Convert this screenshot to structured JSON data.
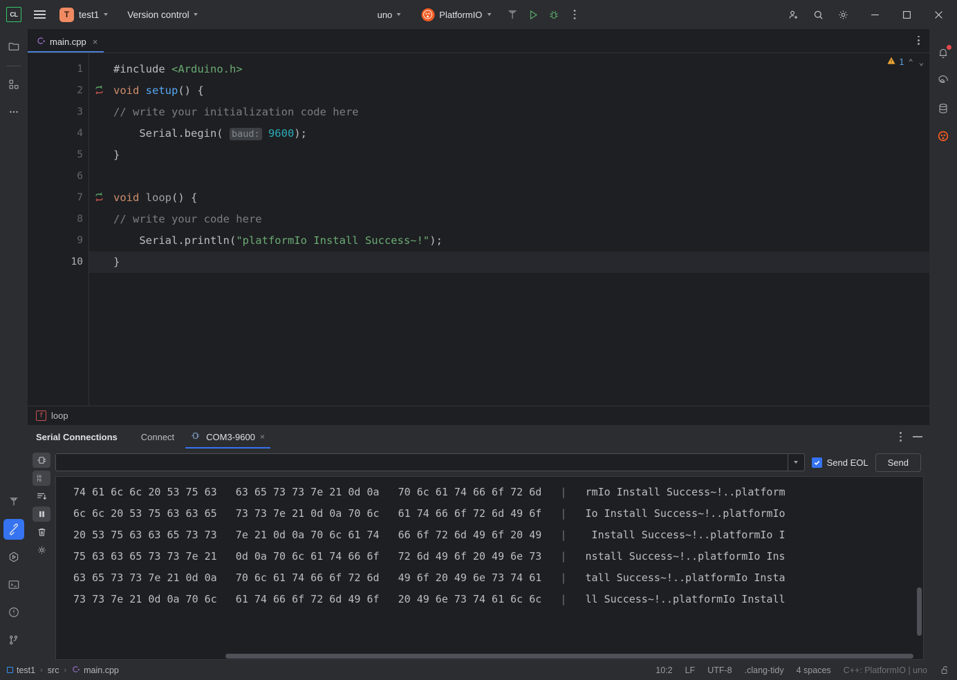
{
  "titlebar": {
    "logo_text": "CL",
    "menu_icon": "hamburger-icon",
    "project_initial": "T",
    "project_name": "test1",
    "vcs_label": "Version control",
    "run_config": "uno",
    "platformio_label": "PlatformIO",
    "icons": {
      "build": "hammer-icon",
      "run": "run-icon",
      "debug": "debug-icon",
      "more": "more-vertical-icon",
      "account": "account-add-icon",
      "search": "search-icon",
      "settings": "gear-icon",
      "minimize": "window-minimize-icon",
      "maximize": "window-maximize-icon",
      "close": "window-close-icon"
    }
  },
  "left_rail": {
    "items": [
      {
        "name": "project-tool-icon",
        "label": "Project"
      },
      {
        "name": "structure-tool-icon",
        "label": "Structure"
      },
      {
        "name": "more-tool-windows-icon",
        "label": "More tool windows"
      }
    ],
    "bottom_items": [
      {
        "name": "build-tool-icon",
        "label": "Build",
        "active": false
      },
      {
        "name": "platformio-tool-icon",
        "label": "PlatformIO",
        "active": true
      },
      {
        "name": "run-tool-icon",
        "label": "Run",
        "active": false
      },
      {
        "name": "terminal-tool-icon",
        "label": "Terminal",
        "active": false
      },
      {
        "name": "problems-tool-icon",
        "label": "Problems",
        "active": false
      },
      {
        "name": "version-control-tool-icon",
        "label": "Version Control",
        "active": false
      }
    ]
  },
  "right_rail": {
    "items": [
      {
        "name": "notifications-icon",
        "label": "Notifications",
        "badge": true
      },
      {
        "name": "ai-assistant-icon",
        "label": "AI Assistant",
        "badge": false
      },
      {
        "name": "database-icon",
        "label": "Database",
        "badge": false
      },
      {
        "name": "platformio-icon",
        "label": "PlatformIO",
        "badge": false
      }
    ]
  },
  "editor": {
    "tab": {
      "label": "main.cpp",
      "icon": "cpp-file-icon",
      "close": "×"
    },
    "warning_count": "1",
    "lines": [
      {
        "n": "1",
        "mark": null
      },
      {
        "n": "2",
        "mark": "override-arrow"
      },
      {
        "n": "3",
        "mark": null
      },
      {
        "n": "4",
        "mark": null
      },
      {
        "n": "5",
        "mark": null
      },
      {
        "n": "6",
        "mark": null
      },
      {
        "n": "7",
        "mark": "override-arrow"
      },
      {
        "n": "8",
        "mark": null
      },
      {
        "n": "9",
        "mark": null
      },
      {
        "n": "10",
        "mark": null
      }
    ],
    "code": [
      "#include <Arduino.h>",
      "void setup() {",
      "// write your initialization code here",
      "    Serial.begin( baud: 9600);",
      "}",
      "",
      "void loop() {",
      "// write your code here",
      "    Serial.println(\"platformIo Install Success~!\");",
      "}"
    ],
    "hint_param": "baud:",
    "breadcrumb_loop": "loop",
    "breadcrumb_loop_badge": "f"
  },
  "panel": {
    "title": "Serial Connections",
    "tabs": [
      {
        "label": "Connect",
        "active": false,
        "icon": null,
        "closable": false
      },
      {
        "label": "COM3-9600",
        "active": true,
        "icon": "plug-icon",
        "closable": true
      }
    ],
    "close_glyph": "×",
    "rail": [
      {
        "name": "connect-icon",
        "selected": false
      },
      {
        "name": "hex-mode-icon",
        "selected": false,
        "label": "EB F0"
      },
      {
        "name": "scroll-to-end-icon",
        "selected": false
      },
      {
        "name": "pause-icon",
        "selected": true
      },
      {
        "name": "clear-icon",
        "selected": false
      },
      {
        "name": "settings-icon",
        "selected": false
      }
    ],
    "send_input_value": "",
    "send_input_placeholder": "",
    "send_eol_label": "Send EOL",
    "send_eol_checked": true,
    "send_button": "Send",
    "hex_rows": [
      {
        "hex": "74 61 6c 6c 20 53 75 63   63 65 73 73 7e 21 0d 0a   70 6c 61 74 66 6f 72 6d",
        "ascii": "rmIo Install Success~!..platform"
      },
      {
        "hex": "6c 6c 20 53 75 63 63 65   73 73 7e 21 0d 0a 70 6c   61 74 66 6f 72 6d 49 6f",
        "ascii": "Io Install Success~!..platformIo"
      },
      {
        "hex": "20 53 75 63 63 65 73 73   7e 21 0d 0a 70 6c 61 74   66 6f 72 6d 49 6f 20 49",
        "ascii": " Install Success~!..platformIo I"
      },
      {
        "hex": "75 63 63 65 73 73 7e 21   0d 0a 70 6c 61 74 66 6f   72 6d 49 6f 20 49 6e 73",
        "ascii": "nstall Success~!..platformIo Ins"
      },
      {
        "hex": "63 65 73 73 7e 21 0d 0a   70 6c 61 74 66 6f 72 6d   49 6f 20 49 6e 73 74 61",
        "ascii": "tall Success~!..platformIo Insta"
      },
      {
        "hex": "73 73 7e 21 0d 0a 70 6c   61 74 66 6f 72 6d 49 6f   20 49 6e 73 74 61 6c 6c",
        "ascii": "ll Success~!..platformIo Install"
      }
    ],
    "separator": "|"
  },
  "statusbar": {
    "breadcrumb": [
      {
        "label": "test1",
        "icon": "module-icon"
      },
      {
        "label": "src",
        "icon": null
      },
      {
        "label": "main.cpp",
        "icon": "cpp-file-icon"
      }
    ],
    "separator": "›",
    "caret": "10:2",
    "line_separator": "LF",
    "encoding": "UTF-8",
    "inspection": ".clang-tidy",
    "indent": "4 spaces",
    "toolchain": "C++: PlatformIO | uno",
    "lock_icon": "unlocked-icon"
  },
  "colors": {
    "accent_blue": "#3573f0",
    "tab_underline": "#4b7fd4",
    "warning_yellow": "#f0a732",
    "string_green": "#6aab73",
    "keyword_orange": "#cf8e6d",
    "number_cyan": "#2aacb8",
    "pio_orange": "#f15b23"
  }
}
